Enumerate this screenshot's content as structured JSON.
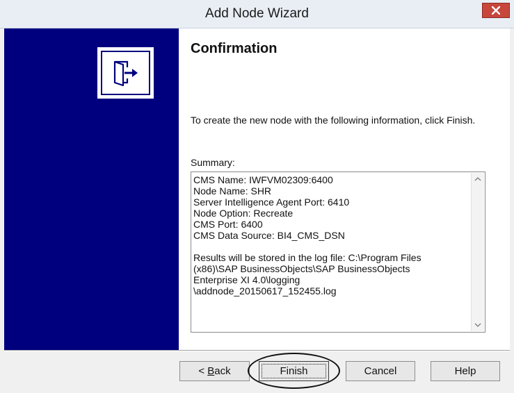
{
  "window": {
    "title": "Add Node Wizard"
  },
  "page": {
    "heading": "Confirmation",
    "instruction": "To create the new node with the following information, click Finish.",
    "summary_label": "Summary:",
    "summary_lines": [
      "CMS Name: IWFVM02309:6400",
      "Node Name: SHR",
      "Server Intelligence Agent Port: 6410",
      "Node Option: Recreate",
      "CMS Port: 6400",
      "CMS Data Source: BI4_CMS_DSN",
      "",
      "Results will be stored in the log file: C:\\Program Files",
      "(x86)\\SAP BusinessObjects\\SAP BusinessObjects",
      "Enterprise XI 4.0\\logging",
      "\\addnode_20150617_152455.log"
    ]
  },
  "buttons": {
    "back_prefix": "< ",
    "back_mnemonic": "B",
    "back_rest": "ack",
    "finish": "Finish",
    "cancel": "Cancel",
    "help": "Help"
  },
  "icons": {
    "banner": "exit-door-arrow-icon",
    "close": "close-icon",
    "scroll_up": "scroll-up-arrow-icon",
    "scroll_down": "scroll-down-arrow-icon"
  },
  "colors": {
    "banner": "#00007f",
    "close_button": "#c7473c"
  }
}
